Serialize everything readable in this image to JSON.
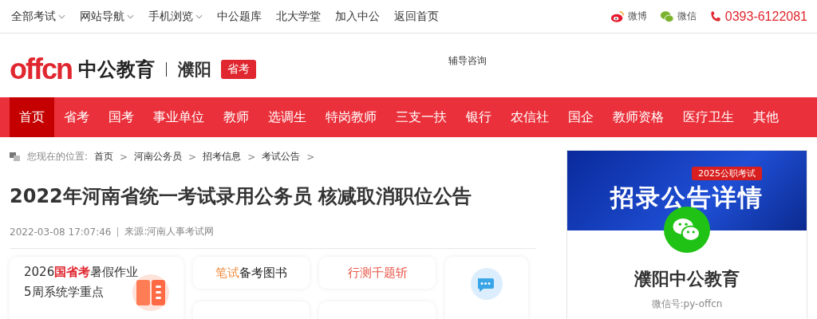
{
  "top_bar": {
    "links": [
      {
        "label": "全部考试",
        "dropdown": true
      },
      {
        "label": "网站导航",
        "dropdown": true
      },
      {
        "label": "手机浏览",
        "dropdown": true
      },
      {
        "label": "中公题库",
        "dropdown": false
      },
      {
        "label": "北大学堂",
        "dropdown": false
      },
      {
        "label": "加入中公",
        "dropdown": false
      },
      {
        "label": "返回首页",
        "dropdown": false
      }
    ],
    "social": [
      {
        "kind": "weibo",
        "label": "微博"
      },
      {
        "kind": "wechat",
        "label": "微信"
      }
    ],
    "phone": "0393-6122081"
  },
  "header": {
    "logo_mark": "offcn",
    "logo_name": "中公教育",
    "city": "濮阳",
    "badge": "省考",
    "consult": "辅导咨询"
  },
  "nav": [
    {
      "label": "首页",
      "selected": true
    },
    {
      "label": "省考",
      "selected": false
    },
    {
      "label": "国考",
      "selected": false
    },
    {
      "label": "事业单位",
      "selected": false
    },
    {
      "label": "教师",
      "selected": false
    },
    {
      "label": "选调生",
      "selected": false
    },
    {
      "label": "特岗教师",
      "selected": false
    },
    {
      "label": "三支一扶",
      "selected": false
    },
    {
      "label": "银行",
      "selected": false
    },
    {
      "label": "农信社",
      "selected": false
    },
    {
      "label": "国企",
      "selected": false
    },
    {
      "label": "教师资格",
      "selected": false
    },
    {
      "label": "医疗卫生",
      "selected": false
    },
    {
      "label": "其他",
      "selected": false
    }
  ],
  "breadcrumb": {
    "prefix": "您现在的位置:",
    "items": [
      "首页",
      "河南公务员",
      "招考信息",
      "考试公告"
    ],
    "separator": ">"
  },
  "article": {
    "title": "2022年河南省统一考试录用公务员 核减取消职位公告",
    "date": "2022-03-08 17:07:46",
    "source": "来源:河南人事考试网"
  },
  "promo": {
    "main": {
      "line1": "2026**国省考**暑假作业",
      "line2": "5周系统学重点"
    },
    "tiles": [
      {
        "kind": "text",
        "parts": [
          {
            "text": "笔试",
            "color": "#f08a3c"
          },
          {
            "text": "备考图书"
          }
        ]
      },
      {
        "kind": "text",
        "parts": [
          {
            "text": "行测千题斩",
            "color": "#e8584a"
          }
        ]
      },
      {
        "kind": "blank"
      },
      {
        "kind": "blank"
      }
    ]
  },
  "sidebar": {
    "banner_top": "2025公职考试",
    "banner_main": "招录公告详情",
    "name": "濮阳中公教育",
    "wechat_id": "微信号:py-offcn"
  }
}
